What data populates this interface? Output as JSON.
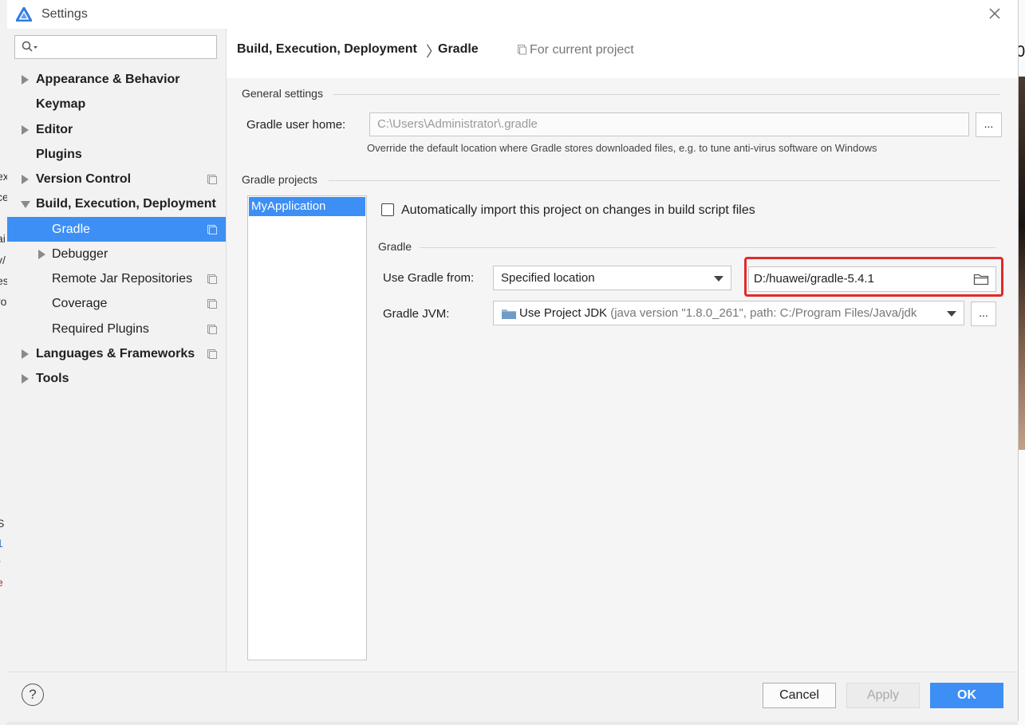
{
  "window": {
    "title": "Settings"
  },
  "search": {
    "value": "",
    "placeholder": ""
  },
  "sidebar": {
    "items": [
      {
        "label": "Appearance & Behavior"
      },
      {
        "label": "Keymap"
      },
      {
        "label": "Editor"
      },
      {
        "label": "Plugins"
      },
      {
        "label": "Version Control"
      },
      {
        "label": "Build, Execution, Deployment"
      },
      {
        "label": "Gradle"
      },
      {
        "label": "Debugger"
      },
      {
        "label": "Remote Jar Repositories"
      },
      {
        "label": "Coverage"
      },
      {
        "label": "Required Plugins"
      },
      {
        "label": "Languages & Frameworks"
      },
      {
        "label": "Tools"
      }
    ]
  },
  "header": {
    "parent": "Build, Execution, Deployment",
    "separator": "〉",
    "current": "Gradle",
    "scope": "For current project"
  },
  "general": {
    "title": "General settings",
    "home_label": "Gradle user home:",
    "home_value": "C:\\Users\\Administrator\\.gradle",
    "browse": "...",
    "hint": "Override the default location where Gradle stores downloaded files, e.g. to tune anti-virus software on Windows"
  },
  "projects": {
    "title": "Gradle projects",
    "items": [
      "MyApplication"
    ],
    "auto_import_label": "Automatically import this project on changes in build script files",
    "auto_import_checked": false,
    "gradle_section": "Gradle",
    "use_from_label": "Use Gradle from:",
    "use_from_value": "Specified location",
    "location_value": "D:/huawei/gradle-5.4.1",
    "jvm_label": "Gradle JVM:",
    "jvm_value": "Use Project JDK",
    "jvm_detail": " (java version \"1.8.0_261\", path: C:/Program Files/Java/jdk",
    "jvm_browse": "..."
  },
  "footer": {
    "help": "?",
    "cancel": "Cancel",
    "apply": "Apply",
    "ok": "OK"
  },
  "background": {
    "left_fragments": [
      "ex",
      "ce",
      "ai",
      "y/",
      "es",
      "ro",
      "S :",
      "1",
      "r",
      "e",
      "t"
    ],
    "right_fragment": "0"
  },
  "colors": {
    "accent": "#3d8ff5",
    "highlight": "#e22a2a"
  }
}
